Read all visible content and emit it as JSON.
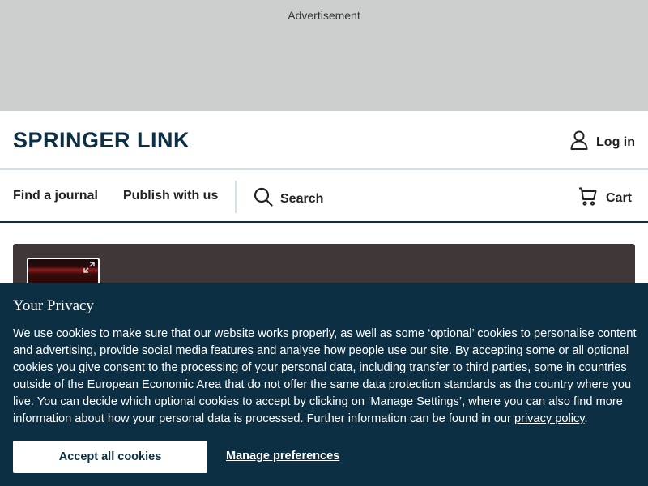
{
  "ad": {
    "label": "Advertisement"
  },
  "header": {
    "logo_text_1": "SPRINGER",
    "logo_text_2": "LINK",
    "login_label": "Log in",
    "login_icon": "user-icon"
  },
  "nav": {
    "find_journal": "Find a journal",
    "publish": "Publish with us",
    "search_label": "Search",
    "search_icon": "search-icon",
    "cart_label": "Cart",
    "cart_icon": "cart-icon"
  },
  "privacy": {
    "title": "Your Privacy",
    "body_before_link": "We use cookies to make sure that our website works properly, as well as some ‘optional’ cookies to personalise content and advertising, provide social media features and analyse how people use our site. By accepting some or all optional cookies you give consent to the processing of your personal data, including transfer to third parties, some in countries outside of the European Economic Area that do not offer the same data protection standards as the country where you live. You can decide which optional cookies to accept by clicking on ‘Manage Settings’, where you can also find more information about how your personal data is processed. Further information can be found in our ",
    "link_text": "privacy policy",
    "body_after_link": ".",
    "accept_label": "Accept all cookies",
    "manage_label": "Manage preferences"
  },
  "colors": {
    "brand_navy": "#0c2f44",
    "ad_gray": "#cdcfce",
    "hero_bg": "#3f3738"
  }
}
